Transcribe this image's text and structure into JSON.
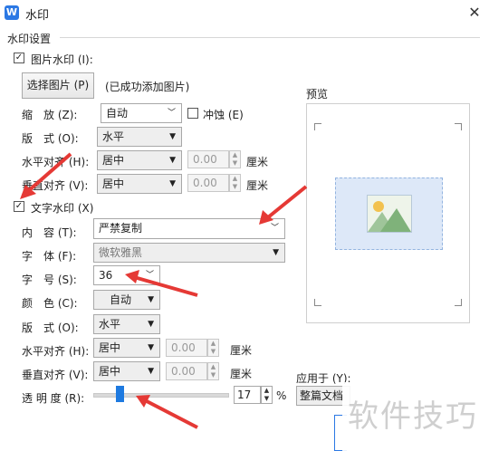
{
  "window": {
    "title": "水印",
    "app_icon_letter": "W"
  },
  "group_title": "水印设置",
  "picture": {
    "checkbox_label": "图片水印 (I):",
    "checked": true,
    "select_button": "选择图片 (P)",
    "status": "(已成功添加图片)",
    "scale_label": "缩　放 (Z):",
    "scale_value": "自动",
    "washout_label": "冲蚀 (E)",
    "layout_label": "版　式 (O):",
    "layout_value": "水平",
    "halign_label": "水平对齐 (H):",
    "halign_value": "居中",
    "halign_offset": "0.00",
    "valign_label": "垂直对齐 (V):",
    "valign_value": "居中",
    "valign_offset": "0.00",
    "unit": "厘米"
  },
  "text": {
    "checkbox_label": "文字水印 (X)",
    "checked": true,
    "content_label": "内　容 (T):",
    "content_value": "严禁复制",
    "font_label": "字　体 (F):",
    "font_value": "微软雅黑",
    "size_label": "字　号 (S):",
    "size_value": "36",
    "color_label": "颜　色 (C):",
    "color_value": "自动",
    "layout_label": "版　式 (O):",
    "layout_value": "水平",
    "halign_label": "水平对齐 (H):",
    "halign_value": "居中",
    "halign_offset": "0.00",
    "valign_label": "垂直对齐 (V):",
    "valign_value": "居中",
    "valign_offset": "0.00",
    "unit": "厘米",
    "transparency_label": "透 明 度 (R):",
    "transparency_value": "17",
    "transparency_fraction": 0.17,
    "percent": "%"
  },
  "preview": {
    "label": "预览"
  },
  "apply": {
    "label": "应用于 (Y):",
    "value": "整篇文档"
  },
  "watermark_brand": "软件技巧",
  "colors": {
    "accent": "#2b78e4",
    "annotation_arrow": "#e53935",
    "slider_thumb": "#1e7ae0"
  }
}
